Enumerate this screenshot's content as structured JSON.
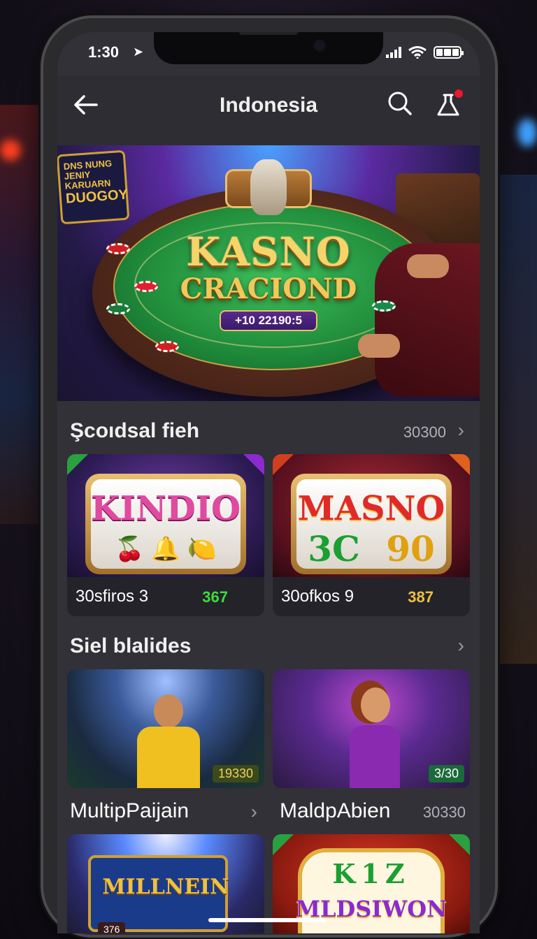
{
  "status": {
    "time": "1:30"
  },
  "nav": {
    "title": "Indonesia"
  },
  "banner": {
    "sign_line1": "DNS NUNG",
    "sign_line2": "JENIY KARUARN",
    "sign_big": "DUOGOY",
    "title": "KASNO",
    "subtitle": "CRACIOND",
    "chip_text": "+10 22190:5"
  },
  "section1": {
    "title": "Şcoıdsal fieh",
    "count": "30300",
    "cards": [
      {
        "reel_title": "KINDIO",
        "name": "30sfiros  3",
        "num": "367",
        "num_color": "#3ddc3d"
      },
      {
        "reel_title": "MASNO",
        "reel_nums_a": "3C",
        "reel_nums_b": "90",
        "name": "30ofkos  9",
        "num": "387",
        "num_color": "#f0c040"
      }
    ]
  },
  "section2": {
    "title": "Siel blalides",
    "photos": [
      {
        "badge": "19330"
      },
      {
        "badge": "3/30"
      }
    ],
    "labels": [
      {
        "text": "MultipPaijain"
      },
      {
        "text": "MaldpAbien",
        "value": "30330"
      }
    ]
  },
  "section3": {
    "tiles": [
      {
        "title": "MILLNEIN",
        "badge": "376"
      },
      {
        "title_a": "K1Z",
        "title_b": "MLDSIWON"
      }
    ]
  }
}
